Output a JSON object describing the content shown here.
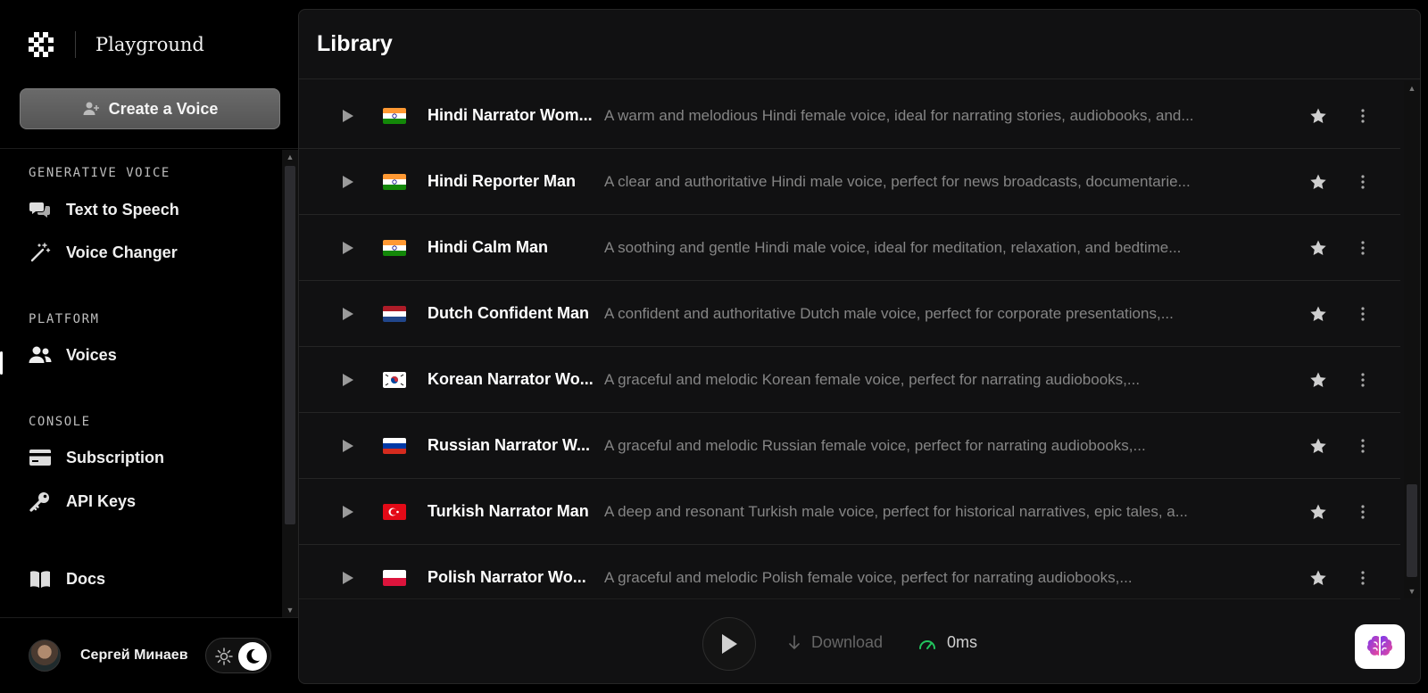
{
  "app": {
    "brand_name": "Playground",
    "create_voice_label": "Create a Voice"
  },
  "sidebar": {
    "sections": [
      {
        "label": "GENERATIVE VOICE",
        "items": [
          {
            "label": "Text to Speech",
            "icon": "chat-bubbles-icon"
          },
          {
            "label": "Voice Changer",
            "icon": "magic-wand-icon"
          }
        ]
      },
      {
        "label": "PLATFORM",
        "items": [
          {
            "label": "Voices",
            "icon": "users-icon",
            "active": true
          }
        ]
      },
      {
        "label": "CONSOLE",
        "items": [
          {
            "label": "Subscription",
            "icon": "credit-card-icon"
          },
          {
            "label": "API Keys",
            "icon": "key-icon"
          }
        ]
      },
      {
        "label": "",
        "items": [
          {
            "label": "Docs",
            "icon": "book-icon"
          }
        ]
      }
    ],
    "user_name": "Сергей Минаев",
    "theme": "dark"
  },
  "library": {
    "title": "Library",
    "voices": [
      {
        "name": "Hindi Narrator Wom...",
        "description": "A warm and melodious Hindi female voice, ideal for narrating stories, audiobooks, and...",
        "flag": "india"
      },
      {
        "name": "Hindi Reporter Man",
        "description": "A clear and authoritative Hindi male voice, perfect for news broadcasts, documentarie...",
        "flag": "india"
      },
      {
        "name": "Hindi Calm Man",
        "description": "A soothing and gentle Hindi male voice, ideal for meditation, relaxation, and bedtime...",
        "flag": "india"
      },
      {
        "name": "Dutch Confident Man",
        "description": "A confident and authoritative Dutch male voice, perfect for corporate presentations,...",
        "flag": "netherlands"
      },
      {
        "name": "Korean Narrator Wo...",
        "description": "A graceful and melodic Korean female voice, perfect for narrating audiobooks,...",
        "flag": "south-korea"
      },
      {
        "name": "Russian Narrator W...",
        "description": "A graceful and melodic Russian female voice, perfect for narrating audiobooks,...",
        "flag": "russia"
      },
      {
        "name": "Turkish Narrator Man",
        "description": "A deep and resonant Turkish male voice, perfect for historical narratives, epic tales, a...",
        "flag": "turkey"
      },
      {
        "name": "Polish Narrator Wo...",
        "description": "A graceful and melodic Polish female voice, perfect for narrating audiobooks,...",
        "flag": "poland"
      }
    ]
  },
  "player": {
    "download_label": "Download",
    "latency": "0ms"
  },
  "colors": {
    "latency_gauge": "#22c55e",
    "flag_india_saffron": "#ff9933",
    "flag_india_green": "#138808",
    "flag_netherlands_red": "#ae1c28",
    "flag_netherlands_blue": "#21468b",
    "flag_turkey_red": "#e30a17",
    "flag_russia_blue": "#0039a6",
    "flag_russia_red": "#d52b1e",
    "flag_poland_red": "#dc143c"
  }
}
